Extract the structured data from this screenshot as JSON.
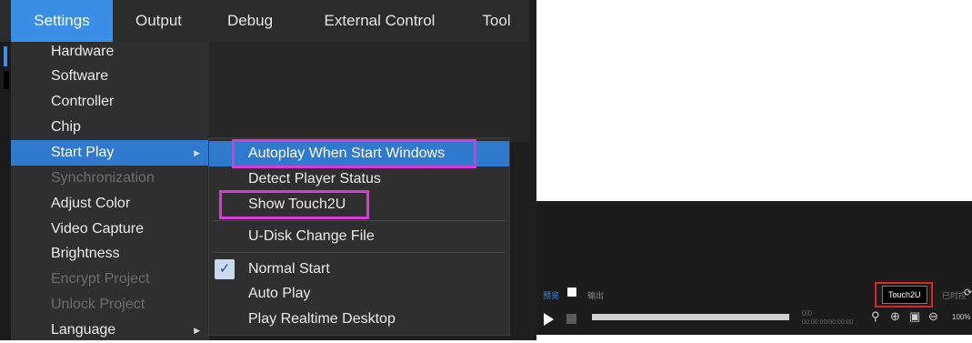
{
  "menubar": {
    "items": [
      {
        "label": "Settings"
      },
      {
        "label": "Output"
      },
      {
        "label": "Debug"
      },
      {
        "label": "External Control"
      },
      {
        "label": "Tool"
      }
    ]
  },
  "settings_menu": {
    "items": [
      {
        "label": "Hardware"
      },
      {
        "label": "Software"
      },
      {
        "label": "Controller"
      },
      {
        "label": "Chip"
      },
      {
        "label": "Start Play"
      },
      {
        "label": "Synchronization"
      },
      {
        "label": "Adjust Color"
      },
      {
        "label": "Video Capture"
      },
      {
        "label": "Brightness"
      },
      {
        "label": "Encrypt Project"
      },
      {
        "label": "Unlock Project"
      },
      {
        "label": "Language"
      }
    ]
  },
  "start_play_submenu": {
    "items": [
      {
        "label": "Autoplay When Start Windows"
      },
      {
        "label": "Detect Player Status"
      },
      {
        "label": "Show Touch2U"
      },
      {
        "label": "U-Disk Change File"
      },
      {
        "label": "Normal Start"
      },
      {
        "label": "Auto Play"
      },
      {
        "label": "Play Realtime Desktop"
      }
    ]
  },
  "player": {
    "tabs": {
      "preview": "预览",
      "output": "输出"
    },
    "touch2u_button": "Touch2U",
    "remote_label": "已时控",
    "counter": "0/0",
    "timecode": "00:00:00/00:00:00",
    "zoom": "100%"
  },
  "colors": {
    "highlight": "#2f79cf",
    "annotation_magenta": "#d63bd6",
    "annotation_red": "#e02424"
  }
}
